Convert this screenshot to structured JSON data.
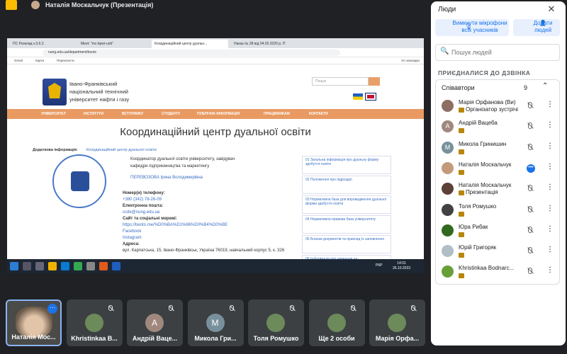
{
  "topbar": {
    "presenter_title": "Наталія Москальчук (Презентація)"
  },
  "browser": {
    "tabs": [
      "ПС Розклад v.3.6.2",
      "Meet: \"mc-kpwr-uxb\"",
      "Координаційний центр дуальн...",
      "Наказ № 28 від 04.02.2020 р. П"
    ],
    "url": "nung.edu.ua/department/koots",
    "bookmarks": [
      "Gmail",
      "Карти",
      "Перекласти",
      "Усі закладки"
    ]
  },
  "site": {
    "uni_line1": "Івано-Франківський",
    "uni_line2": "національний технічний",
    "uni_line3": "університет нафти і газу",
    "search_placeholder": "Пошук",
    "nav": [
      "УНІВЕРСИТЕТ",
      "ІНСТИТУТИ",
      "ВСТУПНИКУ",
      "СТУДЕНТУ",
      "ПУБЛІЧНА ІНФОРМАЦІЯ",
      "ПРАЦІВНИКАМ",
      "КОНТАКТИ"
    ],
    "heading": "Координаційний центр дуальної освіти",
    "extra_label": "Додаткова інформація:",
    "extra_link": "Координаційний центр дуальної освіти",
    "coordinator_line1": "Координатор дуальної освіти університету, завідувач",
    "coordinator_line2": "кафедри  підприємництва та маркетингу",
    "coordinator_name": "ПЕРЕВОЗОВА Ірина Володимирівна",
    "phone_label": "Номер(и) телефону:",
    "phone": "+380 (342) 78-26-09",
    "email_label": "Електронна пошта:",
    "email": "ccde@nung.edu.ua",
    "social_label": "Сайт та соціальні мережі:",
    "social_url": "https://bento.me/%D0%BA%D1%86%D0%B4%D0%BE",
    "facebook": "Facebook",
    "instagram": "Instagram",
    "address_label": "Адреса:",
    "address": "вул. Карпатська, 15, Івано-Франківськ, Україна 76019, навчальний корпус 5, к. 326",
    "right_links": [
      "01 Загальна інформація про дуальну форму здобуття освіти",
      "02 Положення про підрозділ",
      "03 Нормативна база для впровадження дуальної форми здобуття освіти",
      "04 Нормативно-правова база університету",
      "05 Бланки документів та приклад їх заповнення",
      "06 Інформація про навчання на"
    ]
  },
  "taskbar": {
    "time": "14:01",
    "date": "26.10.2023",
    "lang": "РКР"
  },
  "tiles": [
    {
      "name": "Наталія Мос...",
      "color": "#4a4a48",
      "initial": ""
    },
    {
      "name": "Khristinkaa B...",
      "color": "#3c4043",
      "initial": ""
    },
    {
      "name": "Андрій Ваце...",
      "color": "#a1887f",
      "initial": "А"
    },
    {
      "name": "Микола Гри...",
      "color": "#78909c",
      "initial": "М"
    },
    {
      "name": "Толя Ромушко",
      "color": "#3c4043",
      "initial": ""
    },
    {
      "name": "Ще 2 особи",
      "color": "#3c4043",
      "initial": ""
    },
    {
      "name": "Марія Орфа...",
      "color": "#3c4043",
      "initial": ""
    }
  ],
  "panel": {
    "title": "Люди",
    "mute_all": "Вимкнути мікрофони всіх учасників",
    "add_people": "Додати людей",
    "search_placeholder": "Пошук людей",
    "joined_heading": "ПРИЄДНАЛИСЯ ДО ДЗВІНКА",
    "group_label": "Співавтори",
    "group_count": "9",
    "participants": [
      {
        "name": "Марія Орфанова (Ви)",
        "sub": "Організатор зустрічі",
        "initial": "",
        "color": "#8d6e63",
        "speaking": false
      },
      {
        "name": "Андрій Вацеба",
        "sub": "",
        "initial": "А",
        "color": "#a1887f",
        "speaking": false
      },
      {
        "name": "Микола Гринишин",
        "sub": "",
        "initial": "М",
        "color": "#78909c",
        "speaking": false
      },
      {
        "name": "Наталія Москальчук",
        "sub": "",
        "initial": "",
        "color": "#c49a7a",
        "speaking": true
      },
      {
        "name": "Наталія Москальчук",
        "sub": "Презентація",
        "initial": "",
        "color": "#5d4037",
        "speaking": false
      },
      {
        "name": "Толя Ромушко",
        "sub": "",
        "initial": "",
        "color": "#424242",
        "speaking": false
      },
      {
        "name": "Юра Рибак",
        "sub": "",
        "initial": "",
        "color": "#33691e",
        "speaking": false
      },
      {
        "name": "Юрій Григоряк",
        "sub": "",
        "initial": "",
        "color": "#b0bec5",
        "speaking": false
      },
      {
        "name": "Khristinkaa Bodnarc...",
        "sub": "",
        "initial": "",
        "color": "#689f38",
        "speaking": false
      }
    ]
  }
}
